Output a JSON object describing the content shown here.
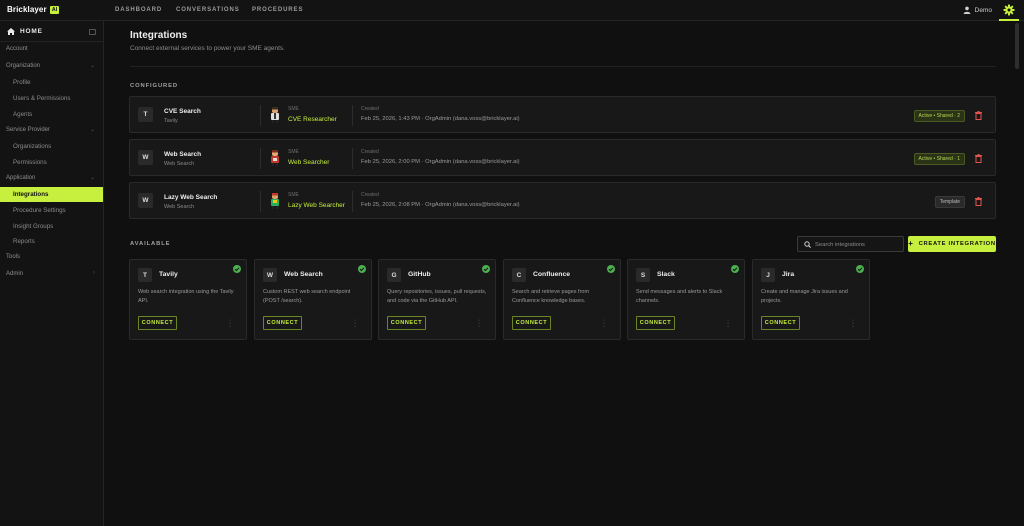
{
  "brand": {
    "name": "Bricklayer",
    "badge": "AI"
  },
  "nav": {
    "tabs": [
      "DASHBOARD",
      "CONVERSATIONS",
      "PROCEDURES"
    ]
  },
  "user": {
    "name": "Demo"
  },
  "sidebar": {
    "home": "HOME",
    "sections": [
      {
        "label": "Account"
      },
      {
        "label": "Organization"
      },
      {
        "label": "Service Provider"
      },
      {
        "label": "Application"
      },
      {
        "label": "Tools"
      },
      {
        "label": "Admin"
      }
    ],
    "items": [
      "Profile",
      "Users & Permissions",
      "Agents",
      "Organizations",
      "Permissions",
      "Integrations",
      "Procedure Settings",
      "Insight Groups",
      "Reports"
    ]
  },
  "page": {
    "title": "Integrations",
    "subtitle": "Connect external services to power your SME agents.",
    "configured_label": "CONFIGURED",
    "available_label": "AVAILABLE"
  },
  "configured": [
    {
      "initial": "T",
      "name": "CVE Search",
      "provider": "Tavily",
      "sme_label": "SME",
      "sme_name": "CVE Researcher",
      "created_label": "Created",
      "created": "Feb 25, 2026, 1:43 PM · OrgAdmin (dana.voss@bricklayer.ai)",
      "status": "Active • Shared · 2"
    },
    {
      "initial": "W",
      "name": "Web Search",
      "provider": "Web Search",
      "sme_label": "SME",
      "sme_name": "Web Searcher",
      "created_label": "Created",
      "created": "Feb 25, 2026, 2:00 PM · OrgAdmin (dana.voss@bricklayer.ai)",
      "status": "Active • Shared · 1"
    },
    {
      "initial": "W",
      "name": "Lazy Web Search",
      "provider": "Web Search",
      "sme_label": "SME",
      "sme_name": "Lazy Web Searcher",
      "created_label": "Created",
      "created": "Feb 25, 2026, 2:08 PM · OrgAdmin (dana.voss@bricklayer.ai)",
      "status": "Template"
    }
  ],
  "search": {
    "placeholder": "Search integrations"
  },
  "create_button": "CREATE INTEGRATION",
  "available": [
    {
      "initial": "T",
      "name": "Tavily",
      "description": "Web search integration using the Tavily API.",
      "action": "CONNECT"
    },
    {
      "initial": "W",
      "name": "Web Search",
      "description": "Custom REST web search endpoint (POST /search).",
      "action": "CONNECT"
    },
    {
      "initial": "G",
      "name": "GitHub",
      "description": "Query repositories, issues, pull requests, and code via the GitHub API.",
      "action": "CONNECT"
    },
    {
      "initial": "C",
      "name": "Confluence",
      "description": "Search and retrieve pages from Confluence knowledge bases.",
      "action": "CONNECT"
    },
    {
      "initial": "S",
      "name": "Slack",
      "description": "Send messages and alerts to Slack channels.",
      "action": "CONNECT"
    },
    {
      "initial": "J",
      "name": "Jira",
      "description": "Create and manage Jira issues and projects.",
      "action": "CONNECT"
    }
  ],
  "colors": {
    "accent": "#c6ef3e",
    "danger": "#e0564f",
    "success": "#4caf50",
    "background": "#101010"
  }
}
